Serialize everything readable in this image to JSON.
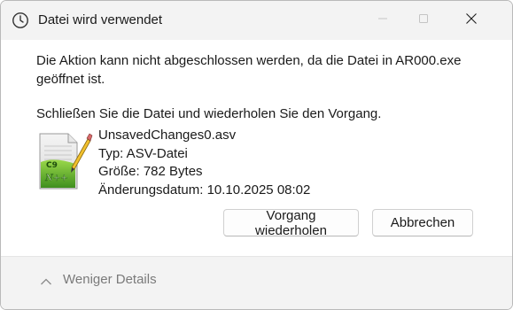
{
  "window": {
    "title": "Datei wird verwendet",
    "title_icon": "clock-icon"
  },
  "caption_buttons": {
    "minimize": "minimize-icon",
    "maximize": "maximize-icon",
    "close": "close-icon"
  },
  "message": {
    "line1": "Die Aktion kann nicht abgeschlossen werden, da die Datei in AR000.exe geöffnet ist.",
    "line2": "Schließen Sie die Datei und wiederholen Sie den Vorgang."
  },
  "file": {
    "icon": "notepad-plus-plus-file-icon",
    "name": "UnsavedChanges0.asv",
    "type": "Typ: ASV-Datei",
    "size": "Größe: 782 Bytes",
    "modified": "Änderungsdatum: 10.10.2025 08:02"
  },
  "buttons": {
    "retry_label": "Vorgang wiederholen",
    "cancel_label": "Abbrechen"
  },
  "footer": {
    "details_label": "Weniger Details",
    "details_icon": "chevron-up-icon"
  }
}
